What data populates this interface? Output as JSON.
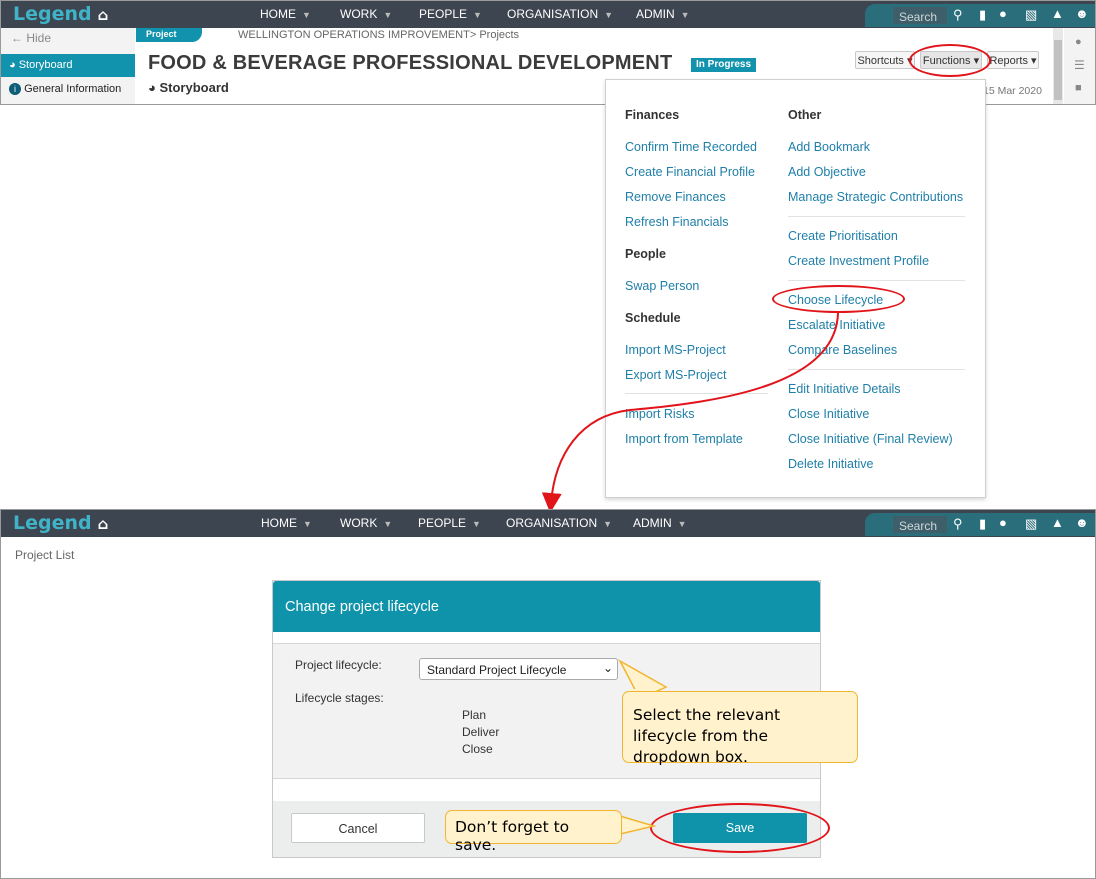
{
  "app": {
    "logo": "Legend"
  },
  "nav": {
    "items": [
      {
        "label": "HOME"
      },
      {
        "label": "WORK"
      },
      {
        "label": "PEOPLE"
      },
      {
        "label": "ORGANISATION"
      },
      {
        "label": "ADMIN"
      }
    ],
    "search_placeholder": "Search"
  },
  "sidebar": {
    "hide": "Hide",
    "items": [
      {
        "label": "Storyboard",
        "active": true
      },
      {
        "label": "General Information",
        "active": false
      }
    ]
  },
  "project": {
    "tag": "Project",
    "breadcrumb": "WELLINGTON OPERATIONS IMPROVEMENT> Projects",
    "title": "FOOD & BEVERAGE PROFESSIONAL DEVELOPMENT",
    "status": "In Progress",
    "subtitle": "Storyboard",
    "date": "15 Mar 2020"
  },
  "toolbar": {
    "shortcuts": "Shortcuts",
    "functions": "Functions",
    "reports": "Reports"
  },
  "functions_menu": {
    "left": [
      {
        "heading": "Finances",
        "items": [
          "Confirm Time Recorded",
          "Create Financial Profile",
          "Remove Finances",
          "Refresh Financials"
        ]
      },
      {
        "heading": "People",
        "items": [
          "Swap Person"
        ]
      },
      {
        "heading": "Schedule",
        "items": [
          "Import MS-Project",
          "Export MS-Project"
        ]
      },
      {
        "heading": "",
        "items": [
          "Import Risks",
          "Import from Template"
        ]
      }
    ],
    "right_heading": "Other",
    "right_groups": [
      [
        "Add Bookmark",
        "Add Objective",
        "Manage Strategic Contributions"
      ],
      [
        "Create Prioritisation",
        "Create Investment Profile"
      ],
      [
        "Choose Lifecycle",
        "Escalate Initiative",
        "Compare Baselines"
      ],
      [
        "Edit Initiative Details",
        "Close Initiative",
        "Close Initiative (Final Review)",
        "Delete Initiative"
      ]
    ]
  },
  "page2": {
    "breadcrumb": "Project List"
  },
  "modal": {
    "title": "Change project lifecycle",
    "lifecycle_label": "Project lifecycle:",
    "lifecycle_value": "Standard Project Lifecycle",
    "stages_label": "Lifecycle stages:",
    "stages": [
      "Plan",
      "Deliver",
      "Close"
    ],
    "cancel": "Cancel",
    "save": "Save"
  },
  "callouts": {
    "dropdown": "Select the relevant lifecycle from the dropdown box.",
    "save": "Don’t forget to save."
  },
  "colors": {
    "nav_bg": "#3d4550",
    "accent": "#0f93aa",
    "annotation_red": "#e1141a",
    "callout_bg": "#fff2cc"
  }
}
